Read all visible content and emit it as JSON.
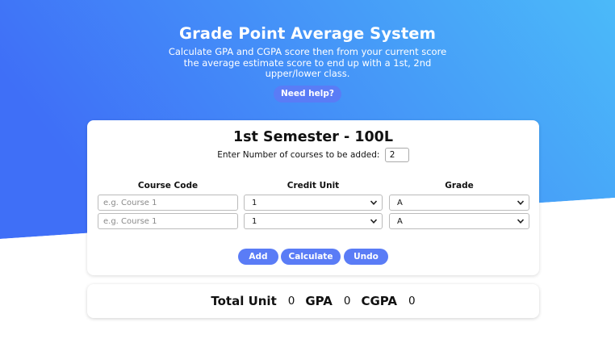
{
  "hero": {
    "title": "Grade Point Average System",
    "subtitle": "Calculate GPA and CGPA score then from your current score the average estimate score to end up with a 1st, 2nd upper/lower class.",
    "help_button": "Need help?"
  },
  "semester": {
    "title": "1st Semester - 100L",
    "count_label": "Enter Number of courses to be added:",
    "count_value": "2",
    "columns": {
      "course_code": "Course Code",
      "credit_unit": "Credit Unit",
      "grade": "Grade"
    },
    "rows": [
      {
        "course_placeholder": "e.g. Course 1",
        "course_value": "",
        "credit_unit": "1",
        "grade": "A"
      },
      {
        "course_placeholder": "e.g. Course 1",
        "course_value": "",
        "credit_unit": "1",
        "grade": "A"
      }
    ],
    "buttons": {
      "add": "Add",
      "calculate": "Calculate",
      "undo": "Undo"
    }
  },
  "totals": {
    "total_unit_label": "Total Unit",
    "total_unit_value": "0",
    "gpa_label": "GPA",
    "gpa_value": "0",
    "cgpa_label": "CGPA",
    "cgpa_value": "0"
  },
  "colors": {
    "gradient_start": "#3f6ff7",
    "gradient_end": "#4bbaf9",
    "button": "#5a7cf6",
    "card": "#ffffff"
  }
}
